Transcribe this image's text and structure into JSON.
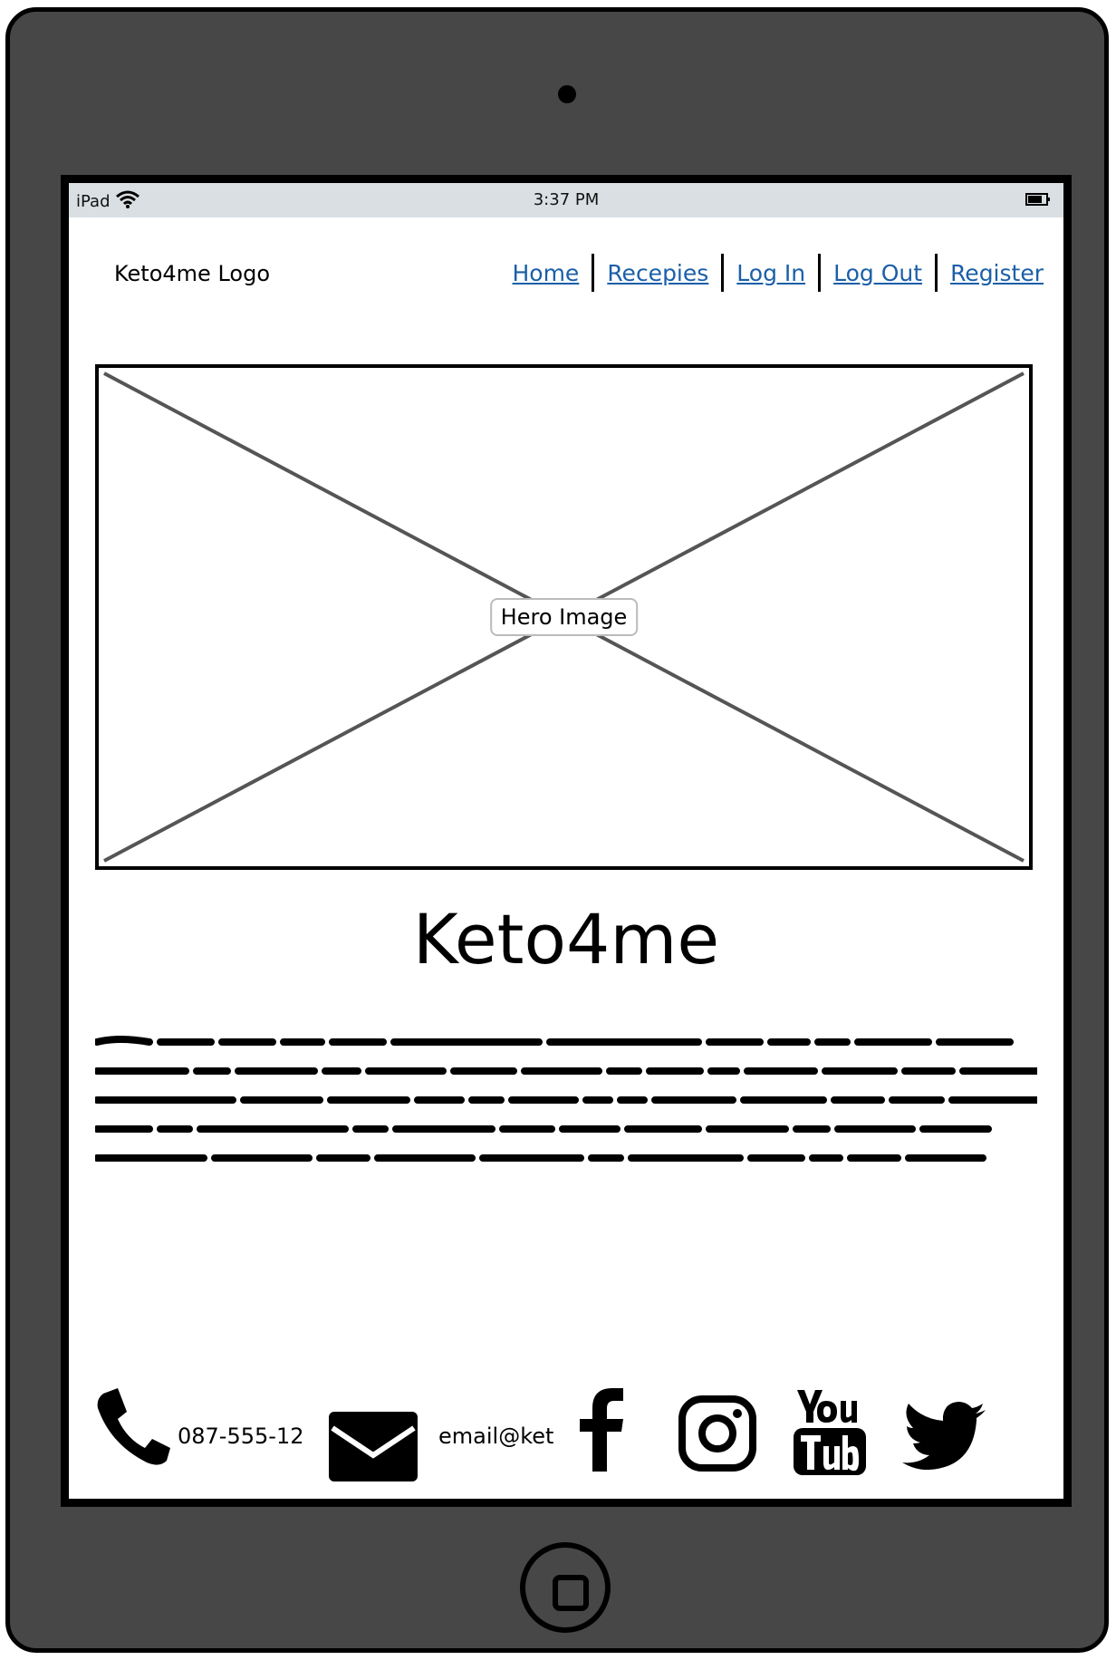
{
  "status_bar": {
    "device": "iPad",
    "time": "3:37 PM"
  },
  "header": {
    "logo": "Keto4me Logo"
  },
  "nav": {
    "home": "Home",
    "recipes": "Recepies",
    "login": "Log In",
    "logout": "Log Out",
    "register": "Register"
  },
  "hero": {
    "label": "Hero Image"
  },
  "main": {
    "title": "Keto4me"
  },
  "footer": {
    "phone": "087-555-12",
    "email": "email@ket"
  },
  "icons": {
    "wifi": "wifi-icon",
    "battery": "battery-icon",
    "phone": "phone-icon",
    "email": "envelope-icon",
    "facebook": "facebook-icon",
    "instagram": "instagram-icon",
    "youtube": "youtube-icon",
    "twitter": "twitter-icon"
  },
  "colors": {
    "link": "#1a5fa8",
    "device": "#474747",
    "status_bar": "#d9dfe2"
  }
}
